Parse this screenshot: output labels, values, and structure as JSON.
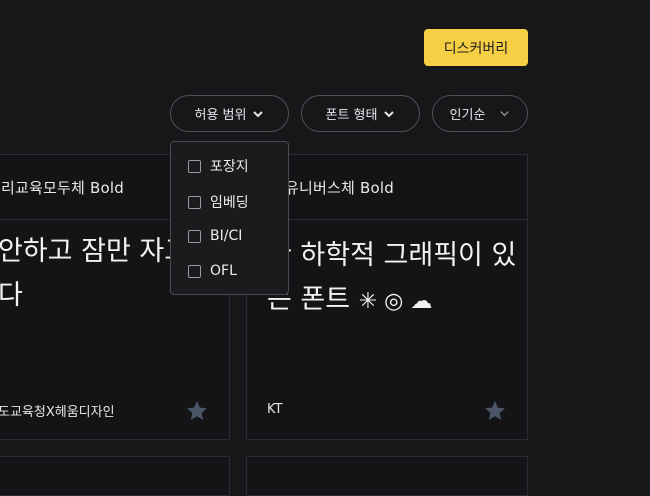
{
  "header": {
    "discover_label": "디스커버리"
  },
  "filters": {
    "license": "허용 범위",
    "font_type": "폰트 형태",
    "sort": "인기순"
  },
  "license_dropdown": {
    "options": [
      "포장지",
      "임베딩",
      "BI/CI",
      "OFL"
    ]
  },
  "cards": [
    {
      "name": "리교육모두체 Bold",
      "preview_line1": "안하고 잠만 자고",
      "preview_line2": "다",
      "author": "도교육청X헤움디자인"
    },
    {
      "name": "유니버스체 Bold",
      "preview_line1": "한 하학적 그래픽이 있",
      "preview_line2": "는 폰트",
      "preview_symbols": "✳ ◎ ☁",
      "author": "KT"
    }
  ],
  "colors": {
    "accent": "#f7cf45",
    "background": "#17171a",
    "star": "#4a5568"
  }
}
